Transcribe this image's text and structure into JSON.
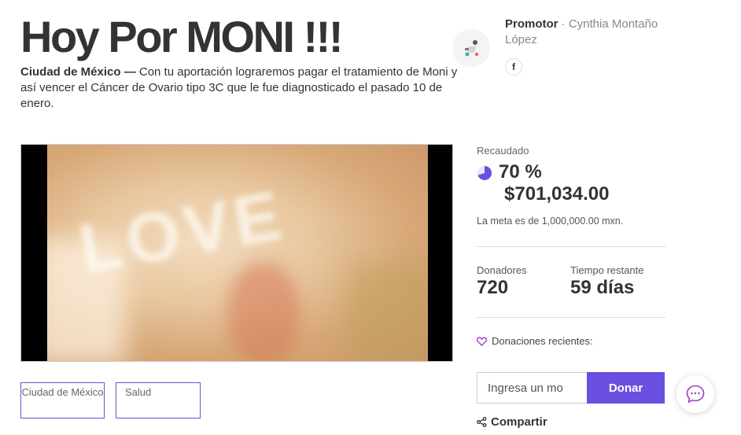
{
  "campaign": {
    "title": "Hoy Por MONI !!!",
    "city": "Ciudad de México —",
    "description": "Con tu aportación lograremos pagar el tratamiento de Moni y así vencer el Cáncer de Ovario tipo 3C que le fue diagnosticado el pasado 10 de enero."
  },
  "promoter": {
    "label": "Promotor",
    "separator": " · ",
    "name": "Cynthia Montaño López",
    "social": "f"
  },
  "media": {
    "video_text": "LOVE"
  },
  "tags": [
    "Ciudad de México",
    "Salud"
  ],
  "stats": {
    "raised_label": "Recaudado",
    "percent": "70 %",
    "progress_fraction": 0.7,
    "amount": "$701,034.00",
    "goal": "La meta es de 1,000,000.00 mxn.",
    "donors_label": "Donadores",
    "donors": "720",
    "time_label": "Tiempo restante",
    "time_left": "59 días",
    "recent_label": "Donaciones recientes:"
  },
  "donate": {
    "placeholder": "Ingresa un mo",
    "button": "Donar"
  },
  "share_label": "Compartir",
  "colors": {
    "accent": "#6b4fe0",
    "tag_border": "#6b4fd8",
    "recent_icon": "#a23bc4"
  },
  "icons": [
    "promoter-avatar-icon",
    "facebook-icon",
    "progress-pie-icon",
    "heart-icon",
    "share-icon",
    "chat-icon"
  ]
}
